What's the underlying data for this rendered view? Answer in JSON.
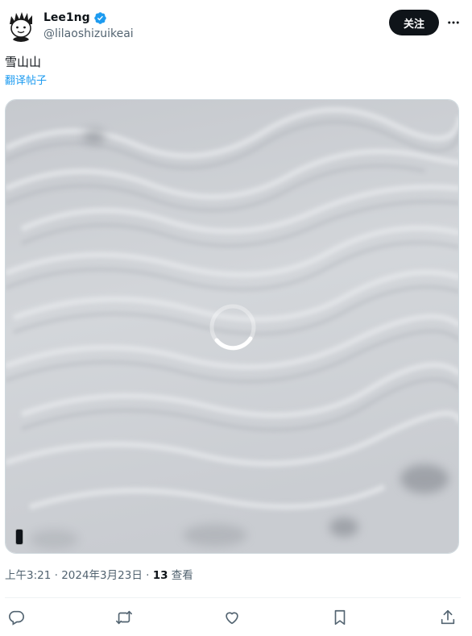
{
  "author": {
    "name": "Lee1ng",
    "handle": "@lilaoshizuikeai",
    "verified": true
  },
  "header": {
    "follow_label": "关注"
  },
  "tweet": {
    "text": "雪山山",
    "translate_label": "翻译帖子"
  },
  "meta": {
    "time": "上午3:21",
    "separator1": " · ",
    "date": "2024年3月23日",
    "separator2": " · ",
    "views_count": "13",
    "views_label": " 查看"
  },
  "icons": {
    "more": "more-dots-icon",
    "verified": "verified-badge-icon",
    "reply": "reply-icon",
    "retweet": "retweet-icon",
    "like": "like-icon",
    "bookmark": "bookmark-icon",
    "share": "share-icon",
    "loading": "loading-spinner-icon"
  },
  "colors": {
    "accent": "#1d9bf0",
    "follow_bg": "#0f1419",
    "secondary_text": "#536471"
  }
}
